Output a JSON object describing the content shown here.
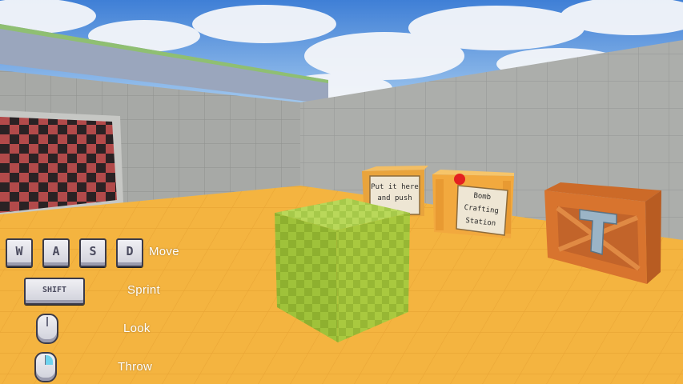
{
  "controls": {
    "keys": [
      "W",
      "A",
      "S",
      "D"
    ],
    "move_label": "Move",
    "shift_key": "SHIFT",
    "sprint_label": "Sprint",
    "look_label": "Look",
    "throw_label": "Throw"
  },
  "signs": {
    "crate_sign": "Put it here and push",
    "station_sign": "Bomb Crafting Station"
  },
  "colors": {
    "floor": "#f2b13c",
    "wall": "#a9aba8",
    "cube": "#9fc23a",
    "checker_dark": "#2a2224",
    "checker_red": "#b04848"
  }
}
